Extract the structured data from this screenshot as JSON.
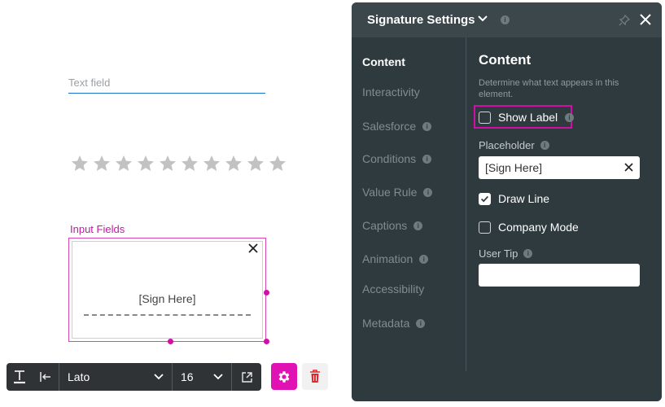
{
  "canvas": {
    "text_field": {
      "placeholder": "Text field"
    },
    "rating": {
      "star_count": 10,
      "filled": 0
    },
    "input_fields_label": "Input Fields",
    "signature_placeholder": "[Sign Here]"
  },
  "toolbar": {
    "font_family": "Lato",
    "font_size": "16"
  },
  "panel": {
    "title": "Signature Settings",
    "nav": [
      {
        "label": "Content",
        "active": true,
        "info": false
      },
      {
        "label": "Interactivity",
        "active": false,
        "info": false
      },
      {
        "label": "Salesforce",
        "active": false,
        "info": true
      },
      {
        "label": "Conditions",
        "active": false,
        "info": true
      },
      {
        "label": "Value Rule",
        "active": false,
        "info": true
      },
      {
        "label": "Captions",
        "active": false,
        "info": true
      },
      {
        "label": "Animation",
        "active": false,
        "info": true
      },
      {
        "label": "Accessibility",
        "active": false,
        "info": false
      },
      {
        "label": "Metadata",
        "active": false,
        "info": true
      }
    ],
    "content": {
      "title": "Content",
      "description": "Determine what text appears in this element.",
      "show_label": {
        "label": "Show Label",
        "checked": false
      },
      "placeholder": {
        "label": "Placeholder",
        "value": "[Sign Here]"
      },
      "draw_line": {
        "label": "Draw Line",
        "checked": true
      },
      "company_mode": {
        "label": "Company Mode",
        "checked": false
      },
      "user_tip": {
        "label": "User Tip",
        "value": ""
      }
    }
  },
  "colors": {
    "accent": "#d10fa6",
    "panel_bg": "#2f3a3e",
    "panel_header": "#3b474b",
    "underline": "#1a73c8"
  }
}
